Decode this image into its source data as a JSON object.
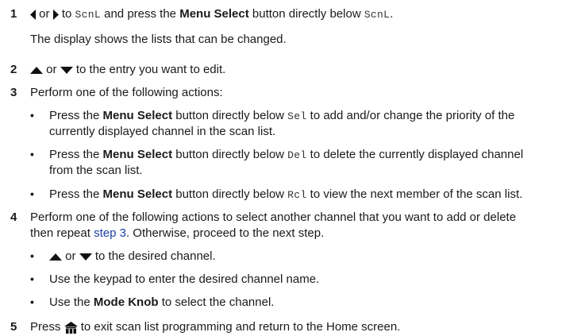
{
  "steps": {
    "s1": {
      "num": "1",
      "or": "or",
      "to": "to",
      "code": "ScnL",
      "t1": "and press the",
      "bold": "Menu Select",
      "t2": "button directly below",
      "end": ".",
      "note": "The display shows the lists that can be changed."
    },
    "s2": {
      "num": "2",
      "or": "or",
      "text": "to the entry you want to edit."
    },
    "s3": {
      "num": "3",
      "text": "Perform one of the following actions:",
      "b1": {
        "pre": "Press the",
        "bold": "Menu Select",
        "mid": "button directly below",
        "code": "Sel",
        "post": "to add and/or change the priority of the",
        "line2": "currently displayed channel in the scan list."
      },
      "b2": {
        "pre": "Press the",
        "bold": "Menu Select",
        "mid": "button directly below",
        "code": "Del",
        "post": "to delete the currently displayed channel",
        "line2": "from the scan list."
      },
      "b3": {
        "pre": "Press the",
        "bold": "Menu Select",
        "mid": "button directly below",
        "code": "Rcl",
        "post": "to view the next member of the scan list."
      }
    },
    "s4": {
      "num": "4",
      "text": "Perform one of the following actions to select another channel that you want to add or delete",
      "line2_pre": "then repeat",
      "link": "step 3",
      "line2_post": ". Otherwise, proceed to the next step.",
      "b1": {
        "or": "or",
        "text": "to the desired channel."
      },
      "b2": {
        "text": "Use the keypad to enter the desired channel name."
      },
      "b3": {
        "pre": "Use the",
        "bold": "Mode Knob",
        "post": "to select the channel."
      }
    },
    "s5": {
      "num": "5",
      "pre": "Press",
      "post": "to exit scan list programming and return to the Home screen."
    }
  },
  "bullet_char": "•",
  "icons": {
    "left": "left-arrow-icon",
    "right": "right-arrow-icon",
    "up": "up-arrow-icon",
    "down": "down-arrow-icon",
    "home": "home-icon"
  }
}
